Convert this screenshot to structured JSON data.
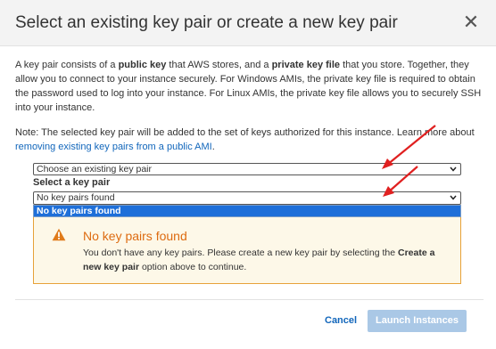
{
  "dialog": {
    "title": "Select an existing key pair or create a new key pair",
    "close_glyph": "✕"
  },
  "intro": {
    "p1_a": "A key pair consists of a ",
    "p1_bold1": "public key",
    "p1_b": " that AWS stores, and a ",
    "p1_bold2": "private key file",
    "p1_c": " that you store. Together, they allow you to connect to your instance securely. For Windows AMIs, the private key file is required to obtain the password used to log into your instance. For Linux AMIs, the private key file allows you to securely SSH into your instance.",
    "p2_a": "Note: The selected key pair will be added to the set of keys authorized for this instance. Learn more about ",
    "p2_link": "removing existing key pairs from a public AMI",
    "p2_end": "."
  },
  "key_pair_action": {
    "selected": "Choose an existing key pair"
  },
  "key_pair_select": {
    "label": "Select a key pair",
    "selected": "No key pairs found",
    "options": [
      "No key pairs found"
    ]
  },
  "warning": {
    "title": "No key pairs found",
    "text_a": "You don't have any key pairs. Please create a new key pair by selecting the ",
    "text_bold": "Create a new key pair",
    "text_b": " option above to continue."
  },
  "footer": {
    "cancel_label": "Cancel",
    "launch_label": "Launch Instances"
  },
  "colors": {
    "link": "#1166bb",
    "warning": "#dd6b10",
    "highlight": "#1e6fd9",
    "annotation_arrow": "#e02020"
  },
  "icons": {
    "close": "close-icon",
    "chevron": "chevron-down-icon",
    "warning": "warning-icon"
  }
}
